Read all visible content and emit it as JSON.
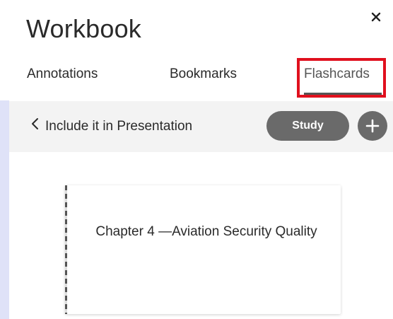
{
  "workbook": {
    "title": "Workbook"
  },
  "tabs": [
    {
      "label": "Annotations"
    },
    {
      "label": "Bookmarks"
    },
    {
      "label": "Flashcards",
      "active": true
    }
  ],
  "subheader": {
    "back_label": "Include it in Presentation",
    "study_label": "Study"
  },
  "flashcard": {
    "text": "Chapter 4 —Aviation Security Quality"
  },
  "icons": {
    "close": "close-icon",
    "back": "chevron-left-icon",
    "add": "plus-icon"
  },
  "colors": {
    "highlight": "#e0101e",
    "button": "#6a6a6a",
    "subheader_bg": "#f3f3f3",
    "left_strip": "#dfe2f8"
  }
}
